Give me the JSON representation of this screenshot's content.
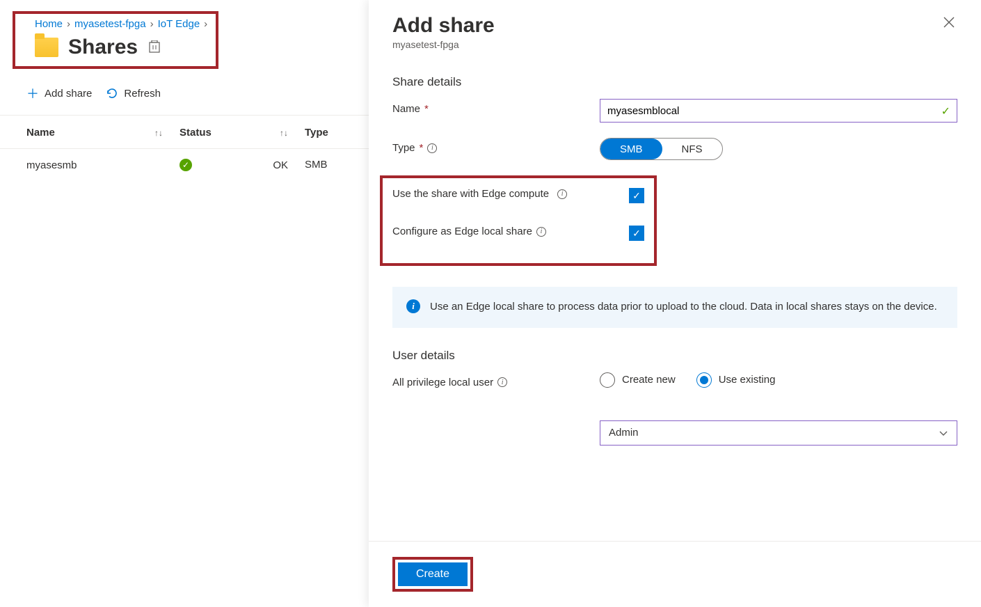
{
  "breadcrumb": {
    "home": "Home",
    "device": "myasetest-fpga",
    "section": "IoT Edge"
  },
  "page": {
    "title": "Shares"
  },
  "toolbar": {
    "add": "Add share",
    "refresh": "Refresh"
  },
  "table": {
    "headers": {
      "name": "Name",
      "status": "Status",
      "type": "Type"
    },
    "rows": [
      {
        "name": "myasesmb",
        "status": "OK",
        "type": "SMB"
      }
    ]
  },
  "panel": {
    "title": "Add share",
    "subtitle": "myasetest-fpga",
    "sections": {
      "share_details": "Share details",
      "user_details": "User details"
    },
    "labels": {
      "name": "Name",
      "type": "Type",
      "edge_compute": "Use the share with Edge compute",
      "edge_local": "Configure as Edge local share",
      "all_priv": "All privilege local user"
    },
    "name_value": "myasesmblocal",
    "type_options": {
      "smb": "SMB",
      "nfs": "NFS"
    },
    "info_text": "Use an Edge local share to process data prior to upload to the cloud. Data in local shares stays on the device.",
    "user_options": {
      "create": "Create new",
      "existing": "Use existing"
    },
    "user_dropdown": "Admin",
    "create_btn": "Create"
  }
}
